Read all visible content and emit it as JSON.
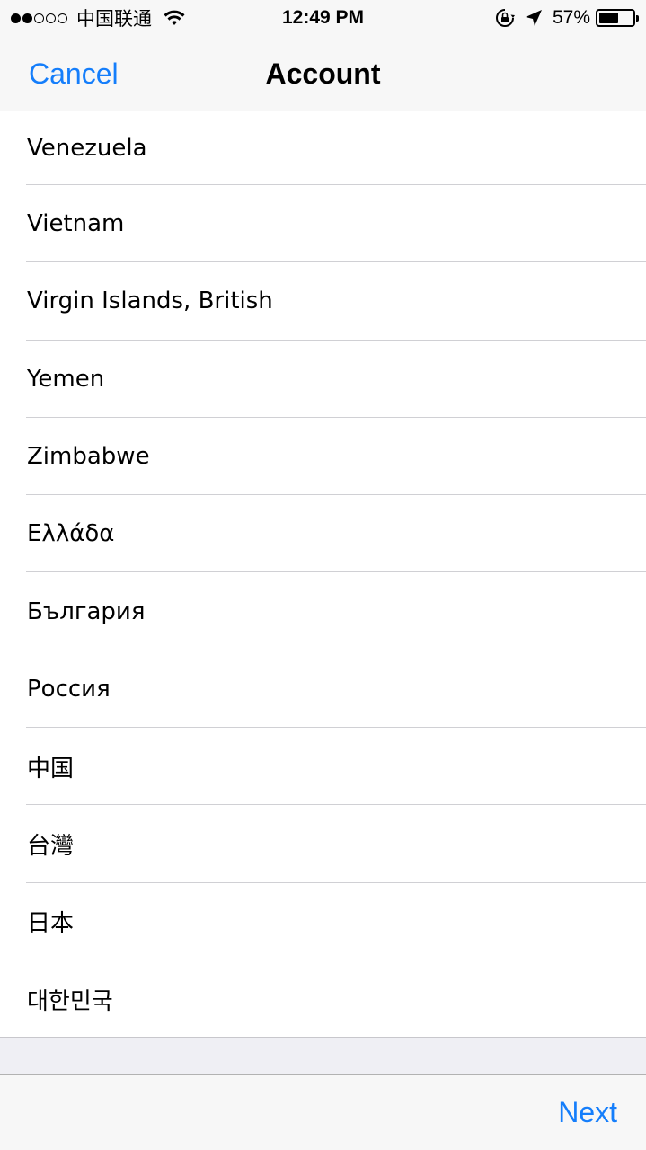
{
  "status_bar": {
    "carrier": "中国联通",
    "signal_strength": 2,
    "signal_max": 5,
    "time": "12:49 PM",
    "battery_percent": "57%",
    "battery_level": 0.57,
    "icons": [
      "wifi-icon",
      "rotation-lock-icon",
      "location-icon",
      "battery-icon"
    ]
  },
  "nav": {
    "cancel_label": "Cancel",
    "title": "Account"
  },
  "countries": [
    "Venezuela",
    "Vietnam",
    "Virgin Islands, British",
    "Yemen",
    "Zimbabwe",
    "Ελλάδα",
    "България",
    "Россия",
    "中国",
    "台灣",
    "日本",
    "대한민국"
  ],
  "toolbar": {
    "next_label": "Next"
  },
  "colors": {
    "accent": "#157efb",
    "bar_background": "#f7f7f7",
    "separator": "#d0d0d4",
    "grouped_background": "#efeff4"
  }
}
